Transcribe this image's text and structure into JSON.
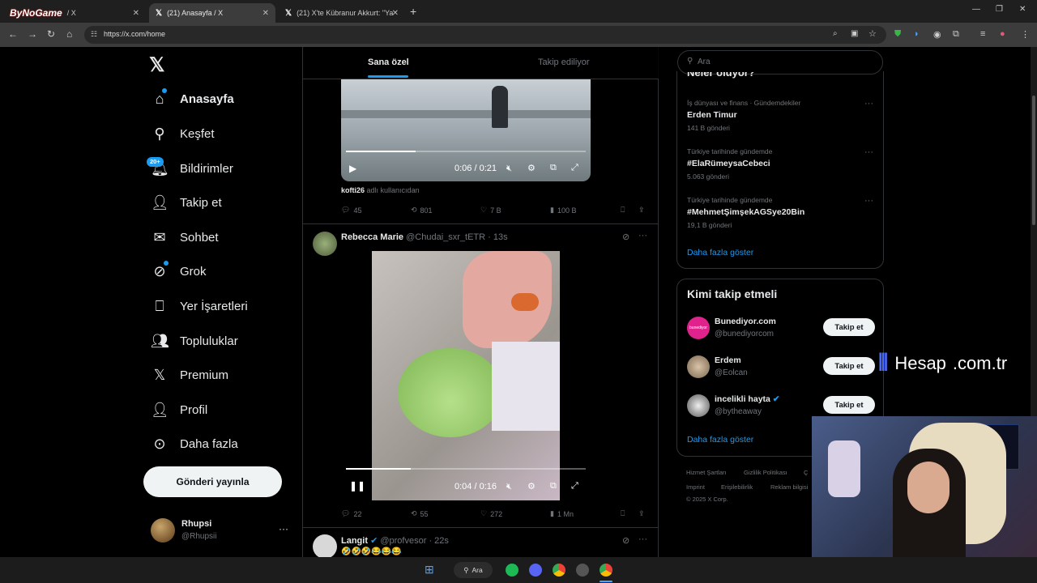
{
  "browser": {
    "tabs": [
      {
        "label": "/ X",
        "watermark": "ByNoGame"
      },
      {
        "label": "(21) Anasayfa / X"
      },
      {
        "label": "(21) X'te Kübranur Akkurt: \"Ya"
      }
    ],
    "url": "https://x.com/home",
    "new_tab": "+"
  },
  "nav": {
    "items": [
      {
        "label": "Anasayfa",
        "icon": "home-icon"
      },
      {
        "label": "Keşfet",
        "icon": "search-icon"
      },
      {
        "label": "Bildirimler",
        "icon": "bell-icon",
        "badge": "20+"
      },
      {
        "label": "Takip et",
        "icon": "follow-icon"
      },
      {
        "label": "Sohbet",
        "icon": "mail-icon"
      },
      {
        "label": "Grok",
        "icon": "grok-icon"
      },
      {
        "label": "Yer İşaretleri",
        "icon": "bookmark-icon"
      },
      {
        "label": "Topluluklar",
        "icon": "communities-icon"
      },
      {
        "label": "Premium",
        "icon": "x-icon"
      },
      {
        "label": "Profil",
        "icon": "profile-icon"
      },
      {
        "label": "Daha fazla",
        "icon": "more-icon"
      }
    ],
    "post_button": "Gönderi yayınla",
    "account": {
      "name": "Rhupsi",
      "handle": "@Rhupsii"
    }
  },
  "feed": {
    "tabs": {
      "for_you": "Sana özel",
      "following": "Takip ediliyor"
    },
    "post1": {
      "video_time": "0:06 / 0:21",
      "video_progress": 0.29,
      "credit_user": "kofti26",
      "credit_suffix": "adlı kullanıcıdan",
      "replies": "45",
      "reposts": "801",
      "likes": "7 B",
      "views": "100 B"
    },
    "post2": {
      "name": "Rebecca Marie",
      "handle": "@Chudai_sxr_tETR",
      "time": "· 13s",
      "video_time": "0:04 / 0:16",
      "video_progress": 0.27,
      "replies": "22",
      "reposts": "55",
      "likes": "272",
      "views": "1 Mn"
    },
    "post3": {
      "name": "Langit",
      "handle": "@profvesor",
      "time": "· 22s",
      "text": "🤣🤣🤣😂😂😂"
    }
  },
  "right": {
    "search_placeholder": "Ara",
    "trends_title": "Neler oluyor?",
    "trends": [
      {
        "category": "İş dünyası ve finans · Gündemdekiler",
        "name": "Erden Timur",
        "count": "141 B gönderi"
      },
      {
        "category": "Türkiye tarihinde gündemde",
        "name": "#ElaRümeysaCebeci",
        "count": "5.063 gönderi"
      },
      {
        "category": "Türkiye tarihinde gündemde",
        "name": "#MehmetŞimşekAGSye20Bin",
        "count": "19,1 B gönderi"
      }
    ],
    "show_more": "Daha fazla göster",
    "who_to_follow_title": "Kimi takip etmeli",
    "suggestions": [
      {
        "name": "Bunediyor.com",
        "handle": "@bunediyorcom",
        "button": "Takip et"
      },
      {
        "name": "Erdem",
        "handle": "@Eolcan",
        "button": "Takip et"
      },
      {
        "name": "incelikli hayta",
        "handle": "@bytheaway",
        "button": "Takip et",
        "verified": true
      }
    ],
    "show_more2": "Daha fazla göster",
    "footer": [
      "Hizmet Şartları",
      "Gizlilik Politikası",
      "Ç",
      "Imprint",
      "Erişilebilirlik",
      "Reklam bilgisi",
      "© 2025 X Corp."
    ]
  },
  "overlay": {
    "brand": "Hesap",
    "domain": ".com.tr"
  },
  "taskbar": {
    "search": "Ara"
  },
  "colors": {
    "accent": "#1d9bf0",
    "bg": "#000000",
    "border": "#2f3336",
    "muted": "#71767b"
  }
}
